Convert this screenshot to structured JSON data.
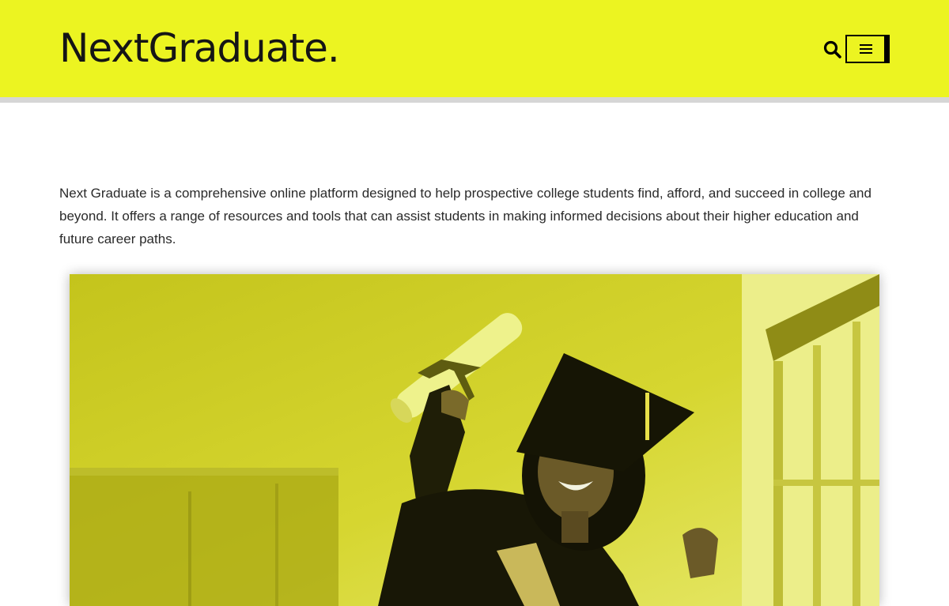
{
  "header": {
    "logo_text": "NextGraduate.",
    "search_icon": "search-icon",
    "menu_icon": "hamburger-menu-icon"
  },
  "intro": {
    "text": "Next Graduate is a comprehensive online platform designed to help prospective college students find, afford, and succeed in college and beyond. It offers a range of resources and tools that can assist students in making informed decisions about their higher education and future career paths."
  },
  "hero_image": {
    "subject": "smiling graduate in cap and gown holding a diploma scroll",
    "tint": "#d4d41a"
  },
  "colors": {
    "brand_yellow": "#ecf421",
    "text_dark": "#151515",
    "body_text": "#2a2a2a"
  }
}
